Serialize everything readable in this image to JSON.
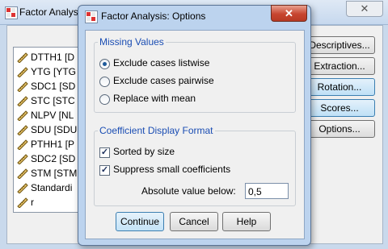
{
  "background_window": {
    "title": "Factor Analys",
    "variables": [
      "DTTH1 [D",
      "YTG [YTG",
      "SDC1 [SD",
      "STC [STC",
      "NLPV [NL",
      "SDU [SDU",
      "PTHH1 [P",
      "SDC2 [SD",
      "STM [STM",
      "Standardi",
      "r"
    ],
    "buttons": [
      "Descriptives...",
      "Extraction...",
      "Rotation...",
      "Scores...",
      "Options..."
    ]
  },
  "dialog": {
    "title": "Factor Analysis: Options",
    "close_label": "✕",
    "missing_values": {
      "legend": "Missing Values",
      "options": [
        {
          "label": "Exclude cases listwise",
          "selected": true
        },
        {
          "label": "Exclude cases pairwise",
          "selected": false
        },
        {
          "label": "Replace with mean",
          "selected": false
        }
      ]
    },
    "coefficient_format": {
      "legend": "Coefficient Display Format",
      "sorted_by_size": {
        "label": "Sorted by size",
        "checked": true
      },
      "suppress_small": {
        "label": "Suppress small coefficients",
        "checked": true
      },
      "absolute_value": {
        "label": "Absolute value below:",
        "value": "0,5"
      }
    },
    "buttons": {
      "continue": "Continue",
      "cancel": "Cancel",
      "help": "Help"
    }
  },
  "colors": {
    "group_legend": "#1a4db3",
    "dialog_frame": "#bcd3ee",
    "close_button": "#c7452f"
  },
  "icons": {
    "variable": "ruler-icon",
    "app": "spss-table-icon"
  }
}
